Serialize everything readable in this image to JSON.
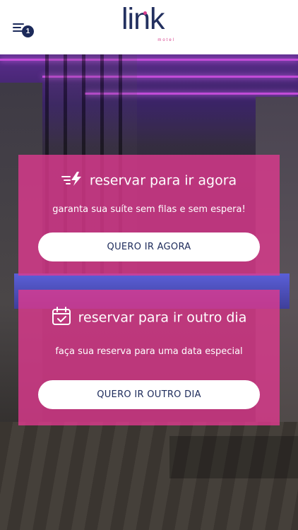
{
  "header": {
    "menu_badge": "1",
    "logo_word": "link",
    "logo_sub": "motel"
  },
  "cards": {
    "now": {
      "title": "reservar para ir agora",
      "subtitle": "garanta sua suíte sem filas e sem espera!",
      "button": "QUERO IR AGORA",
      "icon": "fast-lightning-icon"
    },
    "other": {
      "title": "reservar para ir outro dia",
      "subtitle": "faça sua reserva para uma data especial",
      "button": "QUERO IR OUTRO DIA",
      "icon": "calendar-check-icon"
    }
  },
  "colors": {
    "brand_navy": "#1c2a5a",
    "brand_pink": "#de3a8e",
    "card_overlay": "rgba(222,58,142,0.80)"
  }
}
